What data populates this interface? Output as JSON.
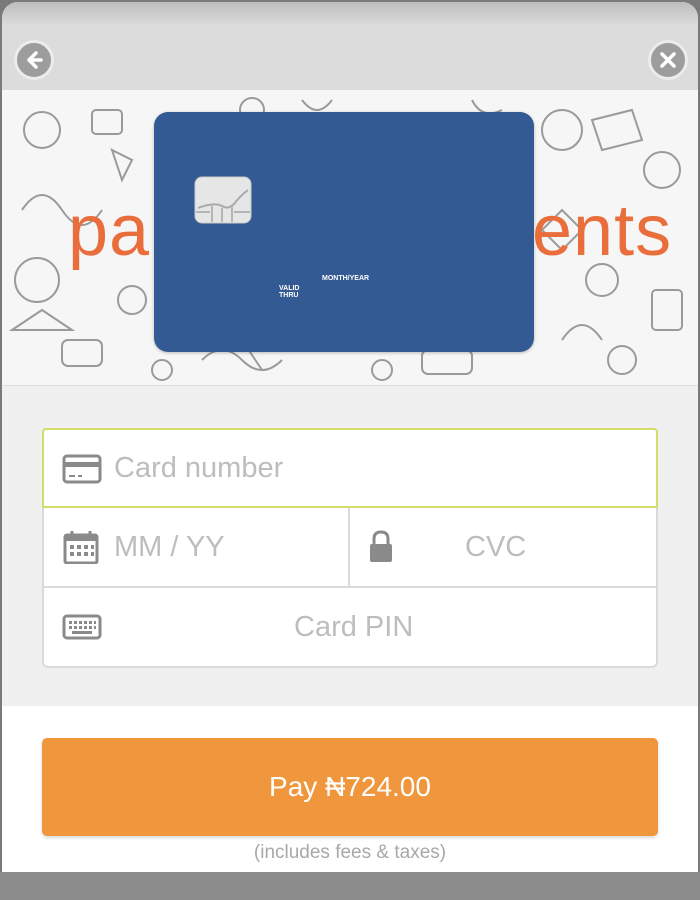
{
  "header": {
    "back_icon": "arrow-left-icon",
    "close_icon": "close-icon"
  },
  "banner": {
    "word_left": "pa",
    "word_right": "ents"
  },
  "card_preview": {
    "valid_label": "VALID THRU",
    "month_label": "MONTH/YEAR",
    "chip_icon": "chip-icon",
    "color": "#345a93"
  },
  "form": {
    "card_number": {
      "placeholder": "Card number",
      "icon": "credit-card-icon"
    },
    "expiry": {
      "placeholder": "MM / YY",
      "icon": "calendar-icon"
    },
    "cvc": {
      "placeholder": "CVC",
      "icon": "lock-icon"
    },
    "pin": {
      "placeholder": "Card PIN",
      "icon": "keyboard-icon"
    }
  },
  "pay": {
    "label": "Pay ₦724.00",
    "note": "(includes fees & taxes)",
    "color": "#f0963c"
  }
}
